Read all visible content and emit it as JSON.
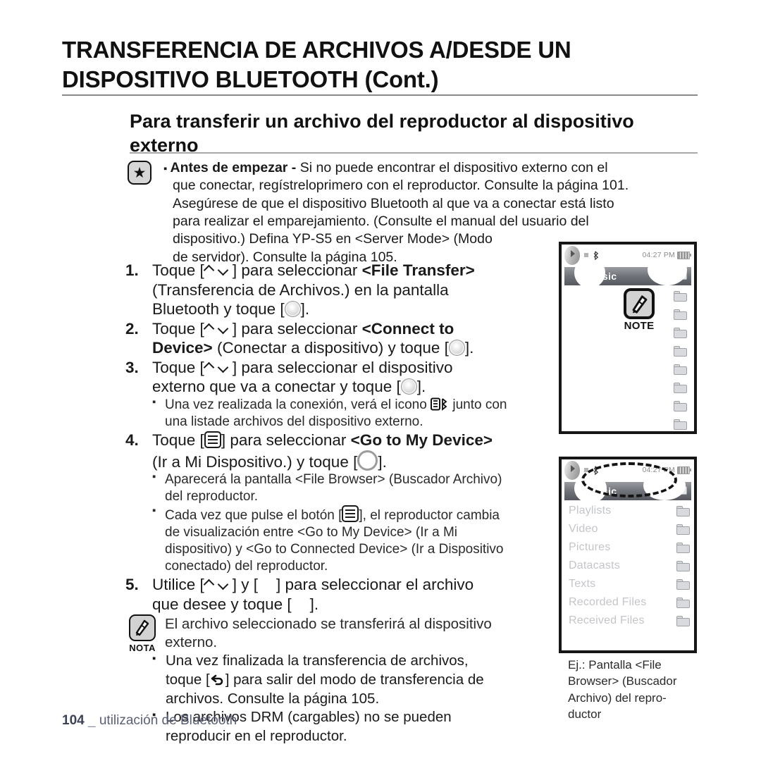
{
  "document": {
    "chapter_title_line1": "TRANSFERENCIA DE ARCHIVOS A/DESDE UN",
    "chapter_title_line2": "DISPOSITIVO BLUETOOTH (Cont.)",
    "section_title_line1": "Para transferir un archivo del reproductor al",
    "section_title_line2": "dispositivo externo"
  },
  "before_note": {
    "icon": "star-icon",
    "label_bold": "Antes de empezar -",
    "lines": [
      "Si no puede encontrar el dispositivo externo con el",
      "que conectar, regístreloprimero con el reproductor. Consulte la página 101.",
      "Asegúrese de que el dispositivo Bluetooth al que va a conectar está listo",
      "para realizar el emparejamiento. (Consulte el manual del usuario del",
      "dispositivo.) Defina YP-S5 en <Server Mode> (Modo",
      "de servidor).  Consulte la página 105."
    ]
  },
  "steps": [
    {
      "number": "1.",
      "lines": [
        {
          "parts": [
            {
              "t": "text",
              "v": "Toque ["
            },
            {
              "t": "icon",
              "v": "updown-chevron-icon"
            },
            {
              "t": "text",
              "v": "] para seleccionar "
            },
            {
              "t": "bold",
              "v": "<File Transfer>"
            }
          ]
        },
        {
          "parts": [
            {
              "t": "text",
              "v": "(Transferencia de Archivos.) en la pantalla"
            }
          ]
        },
        {
          "parts": [
            {
              "t": "text",
              "v": "Bluetooth y toque ["
            },
            {
              "t": "icon",
              "v": "circle-button-icon"
            },
            {
              "t": "text",
              "v": "]."
            }
          ]
        }
      ]
    },
    {
      "number": "2.",
      "lines": [
        {
          "parts": [
            {
              "t": "text",
              "v": "Toque ["
            },
            {
              "t": "icon",
              "v": "updown-chevron-icon"
            },
            {
              "t": "text",
              "v": "] para seleccionar "
            },
            {
              "t": "bold",
              "v": "<Connect to"
            }
          ]
        },
        {
          "parts": [
            {
              "t": "bold",
              "v": "Device>"
            },
            {
              "t": "text",
              "v": " (Conectar a dispositivo) y toque ["
            },
            {
              "t": "icon",
              "v": "circle-button-icon"
            },
            {
              "t": "text",
              "v": "]."
            }
          ]
        }
      ]
    },
    {
      "number": "3.",
      "lines": [
        {
          "parts": [
            {
              "t": "text",
              "v": "Toque ["
            },
            {
              "t": "icon",
              "v": "updown-chevron-icon"
            },
            {
              "t": "text",
              "v": "] para seleccionar el dispositivo"
            }
          ]
        },
        {
          "parts": [
            {
              "t": "text",
              "v": "externo que va a conectar y toque ["
            },
            {
              "t": "icon",
              "v": "circle-button-icon"
            },
            {
              "t": "text",
              "v": "]."
            }
          ]
        }
      ],
      "bullets": [
        {
          "lines": [
            {
              "parts": [
                {
                  "t": "text",
                  "v": "Una vez realizada la conexión, verá el icono "
                },
                {
                  "t": "icon",
                  "v": "bluetooth-connected-icon"
                },
                {
                  "t": "text",
                  "v": " junto con"
                }
              ]
            },
            {
              "parts": [
                {
                  "t": "text",
                  "v": "una listade archivos del dispositivo externo."
                }
              ]
            }
          ]
        }
      ]
    },
    {
      "number": "4.",
      "lines": [
        {
          "parts": [
            {
              "t": "text",
              "v": "Toque ["
            },
            {
              "t": "icon",
              "v": "menu-button-icon"
            },
            {
              "t": "text",
              "v": "] para seleccionar "
            },
            {
              "t": "bold",
              "v": "<Go to My Device>"
            }
          ]
        },
        {
          "parts": [
            {
              "t": "text",
              "v": "(Ir a Mi Dispositivo.) y toque ["
            },
            {
              "t": "icon",
              "v": "circle-outline-icon"
            },
            {
              "t": "text",
              "v": "]."
            }
          ]
        }
      ],
      "bullets": [
        {
          "lines": [
            {
              "parts": [
                {
                  "t": "text",
                  "v": "Aparecerá la pantalla <File Browser> (Buscador Archivo)"
                }
              ]
            },
            {
              "parts": [
                {
                  "t": "text",
                  "v": "del reproductor."
                }
              ]
            }
          ]
        },
        {
          "lines": [
            {
              "parts": [
                {
                  "t": "text",
                  "v": "Cada vez que pulse el botón ["
                },
                {
                  "t": "icon",
                  "v": "menu-button-icon"
                },
                {
                  "t": "text",
                  "v": "], el reproductor cambia"
                }
              ]
            },
            {
              "parts": [
                {
                  "t": "text",
                  "v": "de visualización entre <Go to My Device> (Ir a Mi"
                }
              ]
            },
            {
              "parts": [
                {
                  "t": "text",
                  "v": "dispositivo) y <Go to Connected Device> (Ir a Dispositivo"
                }
              ]
            },
            {
              "parts": [
                {
                  "t": "text",
                  "v": "conectado) del reproductor."
                }
              ]
            }
          ]
        }
      ]
    },
    {
      "number": "5.",
      "lines": [
        {
          "parts": [
            {
              "t": "text",
              "v": "Utilice ["
            },
            {
              "t": "icon",
              "v": "updown-chevron-icon"
            },
            {
              "t": "text",
              "v": "] y ["
            },
            {
              "t": "icon",
              "v": "blank-icon"
            },
            {
              "t": "text",
              "v": "] para seleccionar el archivo"
            }
          ]
        },
        {
          "parts": [
            {
              "t": "text",
              "v": "que desee y toque ["
            },
            {
              "t": "icon",
              "v": "blank-icon"
            },
            {
              "t": "text",
              "v": "]."
            }
          ]
        }
      ]
    }
  ],
  "final_bullets": {
    "plain": [
      {
        "lines": [
          {
            "parts": [
              {
                "t": "text",
                "v": "El archivo seleccionado se transferirá al dispositivo"
              }
            ]
          },
          {
            "parts": [
              {
                "t": "text",
                "v": "externo."
              }
            ]
          }
        ]
      }
    ],
    "note_icon": "note-pen-icon",
    "note_label": "NOTA",
    "noted": [
      {
        "lines": [
          {
            "parts": [
              {
                "t": "text",
                "v": "Una vez finalizada la transferencia de archivos,"
              }
            ]
          },
          {
            "parts": [
              {
                "t": "text",
                "v": "toque ["
              },
              {
                "t": "icon",
                "v": "back-arrow-icon"
              },
              {
                "t": "text",
                "v": "] para salir del modo de transferencia de"
              }
            ]
          },
          {
            "parts": [
              {
                "t": "text",
                "v": "archivos. Consulte la página 105."
              }
            ]
          }
        ]
      },
      {
        "lines": [
          {
            "parts": [
              {
                "t": "text",
                "v": "Los archivos DRM (cargables) no se pueden"
              }
            ]
          },
          {
            "parts": [
              {
                "t": "text",
                "v": "reproducir en el reproductor."
              }
            ]
          }
        ]
      }
    ]
  },
  "device_screen_1": {
    "status_time": "04:27 PM",
    "title_bar_label": "sic",
    "overlay_note_label": "NOTE",
    "folder_row_count": 8
  },
  "device_screen_2": {
    "status_time": "04:27 PM",
    "title_bar_label": "sic",
    "items": [
      {
        "label": "Playlists",
        "icon": "folder-icon"
      },
      {
        "label": "Video",
        "icon": "folder-icon"
      },
      {
        "label": "Pictures",
        "icon": "folder-icon"
      },
      {
        "label": "Datacasts",
        "icon": "folder-icon"
      },
      {
        "label": "Texts",
        "icon": "folder-icon"
      },
      {
        "label": "Recorded Files",
        "icon": "folder-icon"
      },
      {
        "label": "Received Files",
        "icon": "folder-icon"
      }
    ]
  },
  "caption": {
    "lines": [
      "Ej.: Pantalla <File",
      "Browser> (Buscador",
      "Archivo) del repro-",
      "ductor"
    ]
  },
  "footer": {
    "page_number": "104",
    "separator": "_",
    "text": "utilización de Bluetooth"
  },
  "colors": {
    "footer_text": "#5b5f78",
    "device_border": "#161616",
    "title_bar": "#6f7278",
    "list_text": "#c3c5c9"
  }
}
